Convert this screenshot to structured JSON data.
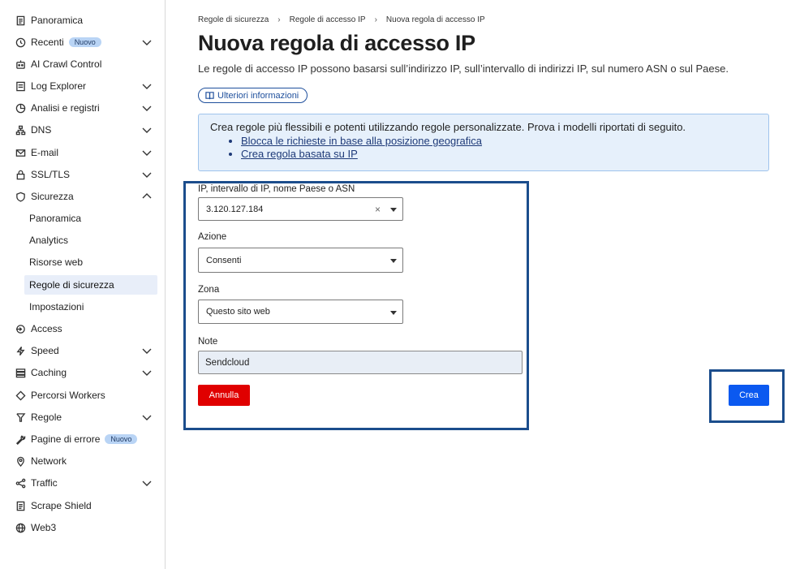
{
  "sidebar": {
    "items": [
      {
        "label": "Panoramica",
        "icon": "document-icon"
      },
      {
        "label": "Recenti",
        "icon": "clock-icon",
        "badge": "Nuovo",
        "chevron": "down"
      },
      {
        "label": "AI Crawl Control",
        "icon": "robot-icon"
      },
      {
        "label": "Log Explorer",
        "icon": "list-icon",
        "chevron": "down"
      },
      {
        "label": "Analisi e registri",
        "icon": "pie-chart-icon",
        "chevron": "down"
      },
      {
        "label": "DNS",
        "icon": "network-icon",
        "chevron": "down"
      },
      {
        "label": "E-mail",
        "icon": "mail-icon",
        "chevron": "down"
      },
      {
        "label": "SSL/TLS",
        "icon": "lock-icon",
        "chevron": "down"
      },
      {
        "label": "Sicurezza",
        "icon": "shield-icon",
        "chevron": "up"
      }
    ],
    "security_sub": [
      {
        "label": "Panoramica"
      },
      {
        "label": "Analytics"
      },
      {
        "label": "Risorse web"
      },
      {
        "label": "Regole di sicurezza",
        "active": true
      },
      {
        "label": "Impostazioni"
      }
    ],
    "items_after": [
      {
        "label": "Access",
        "icon": "access-icon"
      },
      {
        "label": "Speed",
        "icon": "bolt-icon",
        "chevron": "down"
      },
      {
        "label": "Caching",
        "icon": "stack-icon",
        "chevron": "down"
      },
      {
        "label": "Percorsi Workers",
        "icon": "diamond-icon"
      },
      {
        "label": "Regole",
        "icon": "funnel-icon",
        "chevron": "down"
      },
      {
        "label": "Pagine di errore",
        "icon": "wrench-icon",
        "badge": "Nuovo"
      },
      {
        "label": "Network",
        "icon": "pin-icon"
      },
      {
        "label": "Traffic",
        "icon": "share-icon",
        "chevron": "down"
      },
      {
        "label": "Scrape Shield",
        "icon": "document-icon"
      },
      {
        "label": "Web3",
        "icon": "globe-icon"
      }
    ]
  },
  "breadcrumb": [
    "Regole di sicurezza",
    "Regole di accesso IP",
    "Nuova regola di accesso IP"
  ],
  "page": {
    "title": "Nuova regola di accesso IP",
    "description": "Le regole di accesso IP possono basarsi sull’indirizzo IP, sull’intervallo di indirizzi IP, sul numero ASN o sul Paese.",
    "info_button": "Ulteriori informazioni"
  },
  "banner": {
    "text": "Crea regole più flessibili e potenti utilizzando regole personalizzate. Prova i modelli riportati di seguito.",
    "links": [
      "Blocca le richieste in base alla posizione geografica",
      "Crea regola basata su IP"
    ]
  },
  "form": {
    "ip_label": "IP, intervallo di IP, nome Paese o ASN",
    "ip_value": "3.120.127.184",
    "action_label": "Azione",
    "action_value": "Consenti",
    "zone_label": "Zona",
    "zone_value": "Questo sito web",
    "note_label": "Note",
    "note_value": "Sendcloud",
    "cancel": "Annulla",
    "create": "Crea"
  },
  "colors": {
    "highlight": "#1b4d8c",
    "cancel": "#e00000",
    "create": "#0b59f0",
    "banner_bg": "#e6f0fb"
  }
}
